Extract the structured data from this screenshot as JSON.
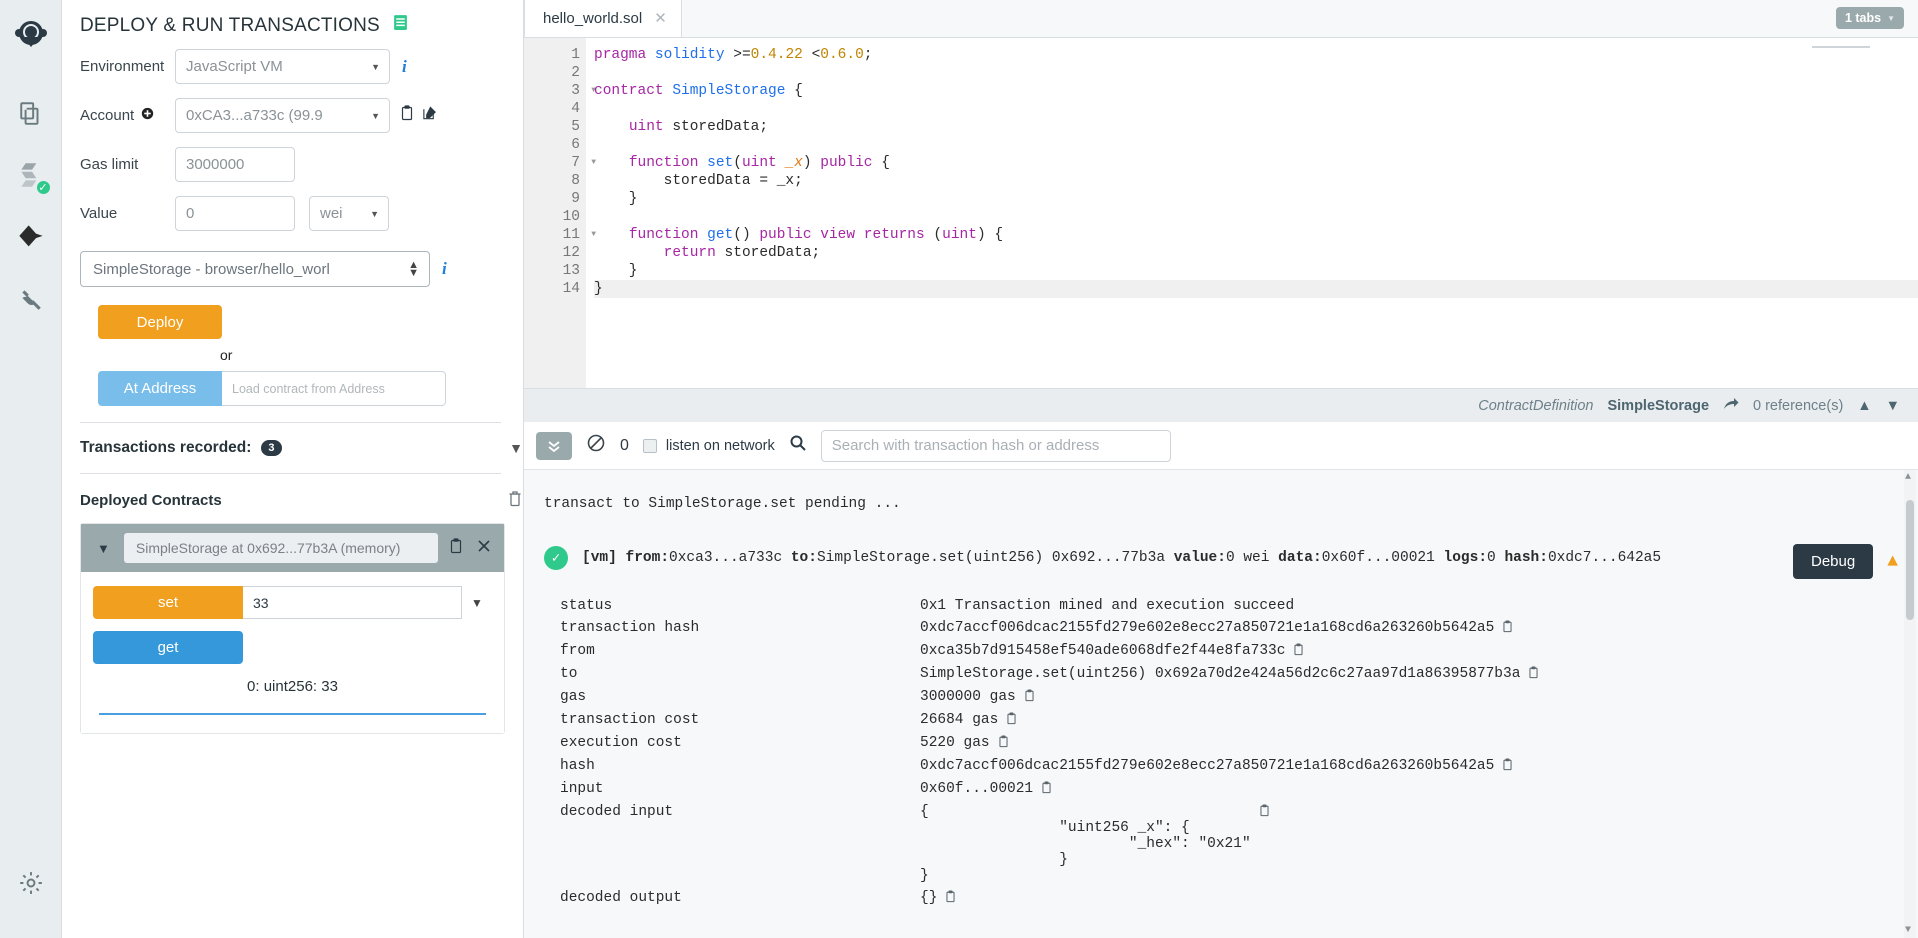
{
  "iconbar": {
    "items": [
      {
        "name": "remix-home-icon",
        "label": "Remix Home"
      },
      {
        "name": "file-explorers-icon",
        "label": "File explorers"
      },
      {
        "name": "solidity-compiler-icon",
        "label": "Solidity compiler",
        "badge": "✓"
      },
      {
        "name": "deploy-run-icon",
        "label": "Deploy & run transactions"
      },
      {
        "name": "plugin-manager-icon",
        "label": "Plugin manager"
      }
    ],
    "settings_label": "Settings"
  },
  "panel": {
    "title": "DEPLOY & RUN TRANSACTIONS",
    "environment_label": "Environment",
    "environment_value": "JavaScript VM",
    "account_label": "Account",
    "account_value": "0xCA3...a733c (99.9",
    "gas_limit_label": "Gas limit",
    "gas_limit_value": "3000000",
    "value_label": "Value",
    "value_value": "0",
    "value_unit": "wei",
    "contract_value": "SimpleStorage - browser/hello_worl",
    "deploy_label": "Deploy",
    "or_label": "or",
    "at_address_label": "At Address",
    "at_address_placeholder": "Load contract from Address",
    "transactions_recorded_label": "Transactions recorded:",
    "transactions_recorded_count": "3",
    "deployed_contracts_label": "Deployed Contracts",
    "instance_name": "SimpleStorage at 0x692...77b3A (memory)",
    "fn_set_label": "set",
    "fn_set_value": "33",
    "fn_get_label": "get",
    "fn_result": "0: uint256: 33"
  },
  "editor": {
    "tab_name": "hello_world.sol",
    "tabs_badge": "1 tabs",
    "lines": [
      {
        "n": 1,
        "fold": false,
        "tokens": [
          [
            "pragma",
            "k-kw"
          ],
          [
            " ",
            "k-plain"
          ],
          [
            "solidity",
            "k-name"
          ],
          [
            " >=",
            "k-plain"
          ],
          [
            "0.4.22",
            "k-num"
          ],
          [
            " <",
            "k-plain"
          ],
          [
            "0.6.0",
            "k-num"
          ],
          [
            ";",
            "k-plain"
          ]
        ]
      },
      {
        "n": 2,
        "fold": false,
        "tokens": []
      },
      {
        "n": 3,
        "fold": true,
        "tokens": [
          [
            "contract",
            "k-kw"
          ],
          [
            " ",
            "k-plain"
          ],
          [
            "SimpleStorage",
            "k-name"
          ],
          [
            " {",
            "k-plain"
          ]
        ]
      },
      {
        "n": 4,
        "fold": false,
        "tokens": []
      },
      {
        "n": 5,
        "fold": false,
        "tokens": [
          [
            "    ",
            "k-plain"
          ],
          [
            "uint",
            "k-type"
          ],
          [
            " storedData;",
            "k-plain"
          ]
        ]
      },
      {
        "n": 6,
        "fold": false,
        "tokens": []
      },
      {
        "n": 7,
        "fold": true,
        "tokens": [
          [
            "    ",
            "k-plain"
          ],
          [
            "function",
            "k-kw"
          ],
          [
            " ",
            "k-plain"
          ],
          [
            "set",
            "k-fn"
          ],
          [
            "(",
            "k-plain"
          ],
          [
            "uint",
            "k-type"
          ],
          [
            " ",
            "k-plain"
          ],
          [
            "_x",
            "k-param"
          ],
          [
            ") ",
            "k-plain"
          ],
          [
            "public",
            "k-kw"
          ],
          [
            " {",
            "k-plain"
          ]
        ]
      },
      {
        "n": 8,
        "fold": false,
        "tokens": [
          [
            "        storedData = _x;",
            "k-plain"
          ]
        ]
      },
      {
        "n": 9,
        "fold": false,
        "tokens": [
          [
            "    }",
            "k-plain"
          ]
        ]
      },
      {
        "n": 10,
        "fold": false,
        "tokens": []
      },
      {
        "n": 11,
        "fold": true,
        "tokens": [
          [
            "    ",
            "k-plain"
          ],
          [
            "function",
            "k-kw"
          ],
          [
            " ",
            "k-plain"
          ],
          [
            "get",
            "k-fn"
          ],
          [
            "() ",
            "k-plain"
          ],
          [
            "public",
            "k-kw"
          ],
          [
            " ",
            "k-plain"
          ],
          [
            "view",
            "k-kw"
          ],
          [
            " ",
            "k-plain"
          ],
          [
            "returns",
            "k-kw"
          ],
          [
            " (",
            "k-plain"
          ],
          [
            "uint",
            "k-type"
          ],
          [
            ") {",
            "k-plain"
          ]
        ]
      },
      {
        "n": 12,
        "fold": false,
        "tokens": [
          [
            "        ",
            "k-plain"
          ],
          [
            "return",
            "k-kw"
          ],
          [
            " storedData;",
            "k-plain"
          ]
        ]
      },
      {
        "n": 13,
        "fold": false,
        "tokens": [
          [
            "    }",
            "k-plain"
          ]
        ]
      },
      {
        "n": 14,
        "fold": false,
        "tokens": [
          [
            "}",
            "k-plain"
          ]
        ],
        "active": true
      }
    ]
  },
  "statusbar": {
    "kind": "ContractDefinition",
    "symbol": "SimpleStorage",
    "references": "0 reference(s)"
  },
  "terminal": {
    "counter": "0",
    "listen_label": "listen on network",
    "search_placeholder": "Search with transaction hash or address",
    "pending_text": "transact to SimpleStorage.set pending ...",
    "debug_label": "Debug",
    "tx_summary": [
      {
        "t": "[vm]",
        "b": true
      },
      {
        "t": " ",
        "b": false
      },
      {
        "t": "from:",
        "b": true
      },
      {
        "t": "0xca3...a733c ",
        "b": false
      },
      {
        "t": "to:",
        "b": true
      },
      {
        "t": "SimpleStorage.set(uint256) 0x692...77b3a ",
        "b": false
      },
      {
        "t": "value:",
        "b": true
      },
      {
        "t": "0 wei ",
        "b": false
      },
      {
        "t": "data:",
        "b": true
      },
      {
        "t": "0x60f...00021 ",
        "b": false
      },
      {
        "t": "logs:",
        "b": true
      },
      {
        "t": "0 ",
        "b": false
      },
      {
        "t": "hash:",
        "b": true
      },
      {
        "t": "0xdc7...642a5",
        "b": false
      }
    ],
    "details": [
      {
        "key": "status",
        "value": "0x1 Transaction mined and execution succeed",
        "copy": false
      },
      {
        "key": "transaction hash",
        "value": "0xdc7accf006dcac2155fd279e602e8ecc27a850721e1a168cd6a263260b5642a5",
        "copy": true
      },
      {
        "key": "from",
        "value": "0xca35b7d915458ef540ade6068dfe2f44e8fa733c",
        "copy": true
      },
      {
        "key": "to",
        "value": "SimpleStorage.set(uint256) 0x692a70d2e424a56d2c6c27aa97d1a86395877b3a",
        "copy": true
      },
      {
        "key": "gas",
        "value": "3000000 gas",
        "copy": true
      },
      {
        "key": "transaction cost",
        "value": "26684 gas",
        "copy": true
      },
      {
        "key": "execution cost",
        "value": "5220 gas",
        "copy": true
      },
      {
        "key": "hash",
        "value": "0xdc7accf006dcac2155fd279e602e8ecc27a850721e1a168cd6a263260b5642a5",
        "copy": true
      },
      {
        "key": "input",
        "value": "0x60f...00021",
        "copy": true
      },
      {
        "key": "decoded input",
        "value": "{\n\t\t\"uint256 _x\": {\n\t\t\t\"_hex\": \"0x21\"\n\t\t}\n}",
        "copy": true
      },
      {
        "key": "decoded output",
        "value": "{}",
        "copy": true
      }
    ]
  },
  "colors": {
    "accent_orange": "#f0a01e",
    "accent_blue": "#3498db",
    "success_green": "#2ec98b",
    "dark": "#2b3a45"
  }
}
